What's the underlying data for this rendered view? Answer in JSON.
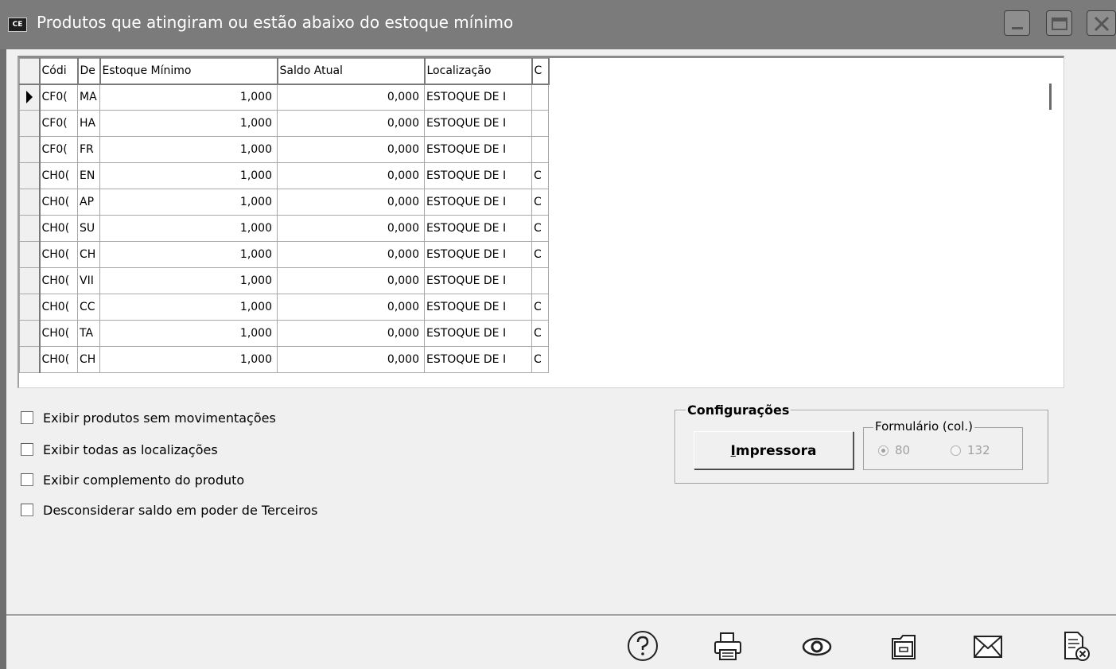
{
  "window": {
    "icon_label": "CE",
    "title": "Produtos que atingiram ou estão abaixo do estoque mínimo"
  },
  "window_controls": [
    "minimize-icon",
    "maximize-icon",
    "close-icon"
  ],
  "grid": {
    "columns": [
      "Códi",
      "De",
      "Estoque Mínimo",
      "Saldo Atual",
      "Localização",
      "C"
    ],
    "rows": [
      [
        "CF0(",
        "MA",
        "1,000",
        "0,000",
        "ESTOQUE DE I",
        ""
      ],
      [
        "CF0(",
        "HA",
        "1,000",
        "0,000",
        "ESTOQUE DE I",
        ""
      ],
      [
        "CF0(",
        "FR",
        "1,000",
        "0,000",
        "ESTOQUE DE I",
        ""
      ],
      [
        "CH0(",
        "EN",
        "1,000",
        "0,000",
        "ESTOQUE DE I",
        "C"
      ],
      [
        "CH0(",
        "AP",
        "1,000",
        "0,000",
        "ESTOQUE DE I",
        "C"
      ],
      [
        "CH0(",
        "SU",
        "1,000",
        "0,000",
        "ESTOQUE DE I",
        "C"
      ],
      [
        "CH0(",
        "CH",
        "1,000",
        "0,000",
        "ESTOQUE DE I",
        "C"
      ],
      [
        "CH0(",
        "VII",
        "1,000",
        "0,000",
        "ESTOQUE DE I",
        ""
      ],
      [
        "CH0(",
        "CC",
        "1,000",
        "0,000",
        "ESTOQUE DE I",
        "C"
      ],
      [
        "CH0(",
        "TA",
        "1,000",
        "0,000",
        "ESTOQUE DE I",
        "C"
      ],
      [
        "CH0(",
        "CH",
        "1,000",
        "0,000",
        "ESTOQUE DE I",
        "C"
      ]
    ]
  },
  "options": {
    "exibir_sem_mov": "Exibir produtos sem movimentações",
    "exibir_localizacoes": "Exibir todas as localizações",
    "exibir_complemento": "Exibir complemento do produto",
    "desconsiderar_terceiros": "Desconsiderar saldo em poder de Terceiros"
  },
  "config": {
    "legend": "Configurações",
    "printer_button": "Impressora",
    "form_legend": "Formulário (col.)",
    "radio_80": "80",
    "radio_132": "132",
    "selected": "80"
  },
  "toolbar": [
    "help-icon",
    "printer-icon",
    "preview-icon",
    "folder-icon",
    "email-icon",
    "close-report-icon"
  ]
}
